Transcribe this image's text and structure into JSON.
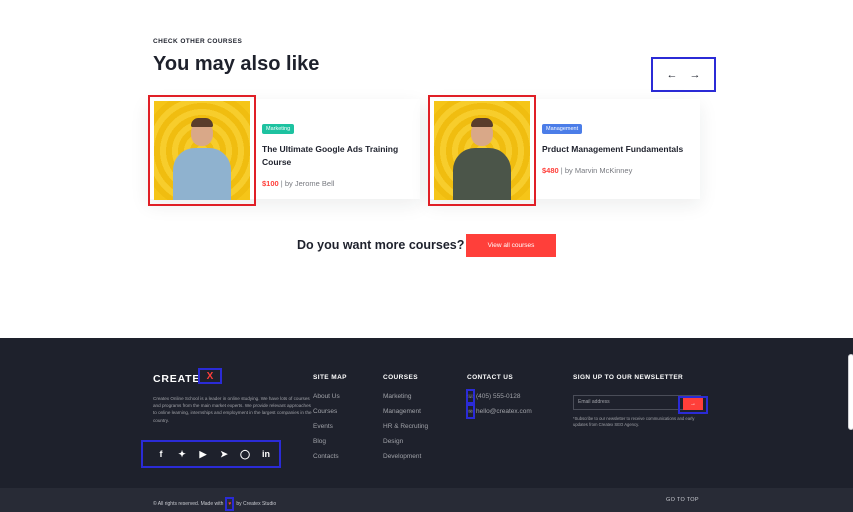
{
  "courses_section": {
    "eyebrow": "CHECK OTHER COURSES",
    "title": "You may also like",
    "arrows": {
      "prev": "←",
      "next": "→"
    },
    "cards": [
      {
        "badge": "Marketing",
        "badge_color": "#1dc2a0",
        "title": "The Ultimate Google Ads Training Course",
        "price": "$100",
        "author": "| by Jerome Bell"
      },
      {
        "badge": "Management",
        "badge_color": "#4b7de8",
        "title": "Prduct Management Fundamentals",
        "price": "$480",
        "author": "| by Marvin McKinney"
      }
    ],
    "more_text": "Do you want more courses?",
    "view_all_button": "View all courses"
  },
  "footer": {
    "logo": "CREATE",
    "logo_x": "X",
    "about": "Createx Online School is a leader in online studying. We have lots of courses and programs from the main market experts. We provide relevant approaches to online learning, internships and employment in the largest companies in the country.",
    "socials": [
      "facebook-icon",
      "twitter-icon",
      "youtube-icon",
      "telegram-icon",
      "instagram-icon",
      "linkedin-icon"
    ],
    "site_map": {
      "heading": "SITE MAP",
      "links": [
        "About Us",
        "Courses",
        "Events",
        "Blog",
        "Contacts"
      ]
    },
    "courses": {
      "heading": "COURSES",
      "links": [
        "Marketing",
        "Management",
        "HR & Recruting",
        "Design",
        "Development"
      ]
    },
    "contact": {
      "heading": "CONTACT US",
      "phone": "(405) 555-0128",
      "email": "hello@createx.com"
    },
    "newsletter": {
      "heading": "SIGN UP TO OUR NEWSLETTER",
      "placeholder": "Email address",
      "fine_print": "*Subscribe to our newsletter to receive communications and early updates from Createx SEO Agency."
    },
    "copyright_pre": "© All rights reserved. Made with",
    "copyright_post": "by Createx Studio",
    "go_to_top": "GO TO TOP"
  },
  "colors": {
    "accent": "#ff3f3a",
    "footer_bg": "#1e212c",
    "highlight": "#2b2bd6"
  }
}
